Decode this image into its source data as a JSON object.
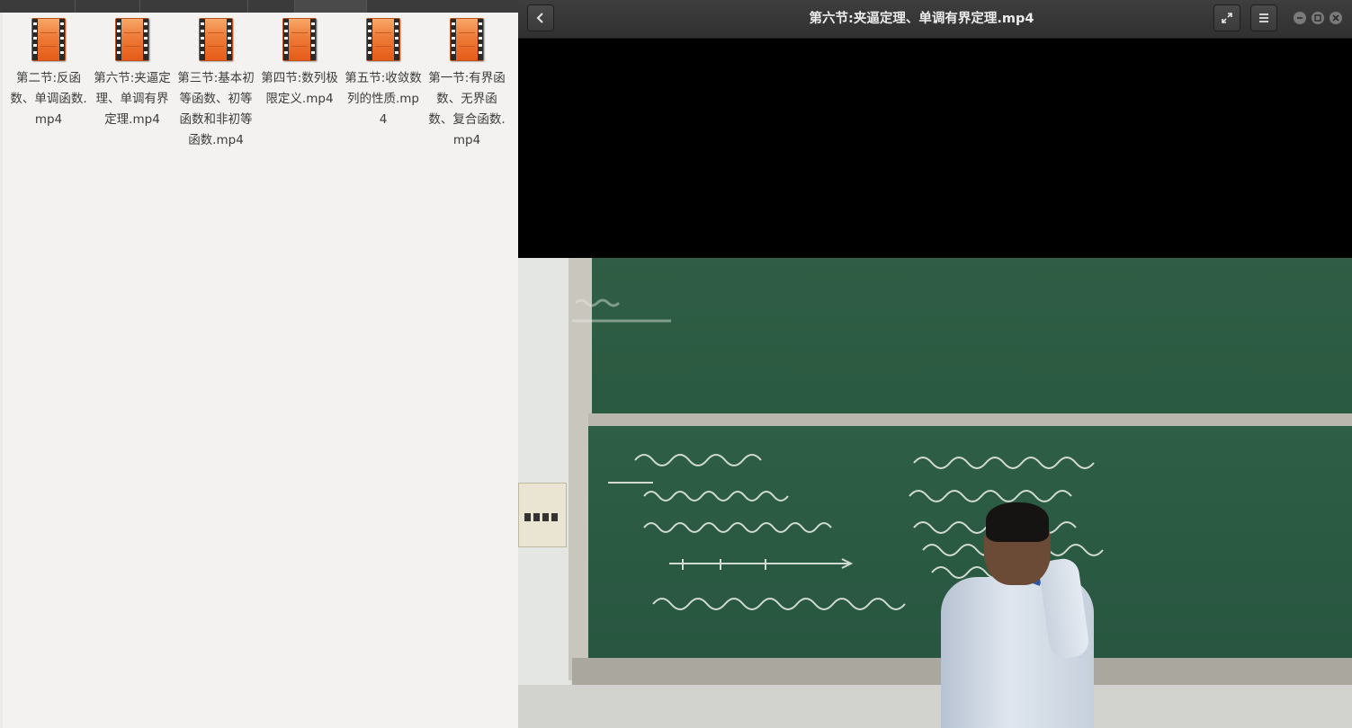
{
  "file_manager": {
    "files": [
      {
        "name": "第二节:反函数、单调函数.mp4",
        "icon": "video-file-icon"
      },
      {
        "name": "第六节:夹逼定理、单调有界定理.mp4",
        "icon": "video-file-icon"
      },
      {
        "name": "第三节:基本初等函数、初等函数和非初等函数.mp4",
        "icon": "video-file-icon"
      },
      {
        "name": "第四节:数列极限定义.mp4",
        "icon": "video-file-icon"
      },
      {
        "name": "第五节:收敛数列的性质.mp4",
        "icon": "video-file-icon"
      },
      {
        "name": "第一节:有界函数、无界函数、复合函数.mp4",
        "icon": "video-file-icon"
      }
    ]
  },
  "player": {
    "title": "第六节:夹逼定理、单调有界定理.mp4",
    "back_icon": "back-arrow-icon",
    "fullscreen_icon": "fullscreen-icon",
    "menu_icon": "hamburger-menu-icon",
    "window_controls": [
      "minimize",
      "maximize",
      "close"
    ]
  },
  "colors": {
    "header_bg": "#353535",
    "video_bg": "#000000",
    "chalkboard": "#2c5b43",
    "file_view_bg": "#f3f2f1",
    "file_icon": "#ee7a37"
  }
}
